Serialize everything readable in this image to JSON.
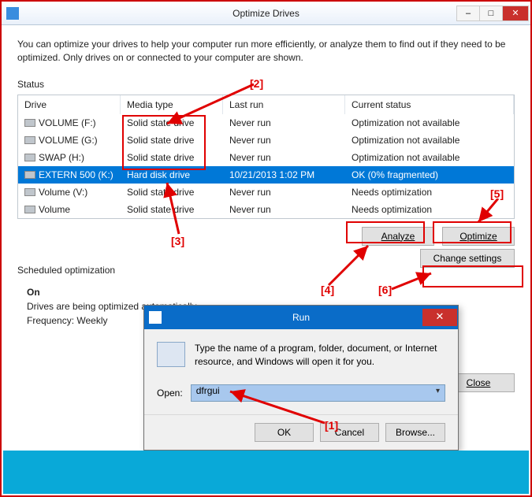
{
  "window": {
    "title": "Optimize Drives",
    "description": "You can optimize your drives to help your computer run more efficiently, or analyze them to find out if they need to be optimized. Only drives on or connected to your computer are shown."
  },
  "status_label": "Status",
  "table": {
    "headers": {
      "drive": "Drive",
      "media": "Media type",
      "last": "Last run",
      "status": "Current status"
    },
    "rows": [
      {
        "drive": "VOLUME (F:)",
        "media": "Solid state drive",
        "last": "Never run",
        "status": "Optimization not available",
        "selected": false
      },
      {
        "drive": "VOLUME (G:)",
        "media": "Solid state drive",
        "last": "Never run",
        "status": "Optimization not available",
        "selected": false
      },
      {
        "drive": "SWAP (H:)",
        "media": "Solid state drive",
        "last": "Never run",
        "status": "Optimization not available",
        "selected": false
      },
      {
        "drive": "EXTERN 500 (K:)",
        "media": "Hard disk drive",
        "last": "10/21/2013 1:02 PM",
        "status": "OK (0% fragmented)",
        "selected": true
      },
      {
        "drive": "Volume (V:)",
        "media": "Solid state drive",
        "last": "Never run",
        "status": "Needs optimization",
        "selected": false
      },
      {
        "drive": "Volume",
        "media": "Solid state drive",
        "last": "Never run",
        "status": "Needs optimization",
        "selected": false
      }
    ]
  },
  "buttons": {
    "analyze": "Analyze",
    "optimize": "Optimize",
    "change_settings": "Change settings",
    "close": "Close"
  },
  "scheduled": {
    "label": "Scheduled optimization",
    "on": "On",
    "line1": "Drives are being optimized automatically.",
    "line2": "Frequency: Weekly"
  },
  "run_dialog": {
    "title": "Run",
    "desc": "Type the name of a program, folder, document, or Internet resource, and Windows will open it for you.",
    "open_label": "Open:",
    "open_value": "dfrgui",
    "ok": "OK",
    "cancel": "Cancel",
    "browse": "Browse..."
  },
  "annotations": {
    "l1": "[1]",
    "l2": "[2]",
    "l3": "[3]",
    "l4": "[4]",
    "l5": "[5]",
    "l6": "[6]"
  }
}
